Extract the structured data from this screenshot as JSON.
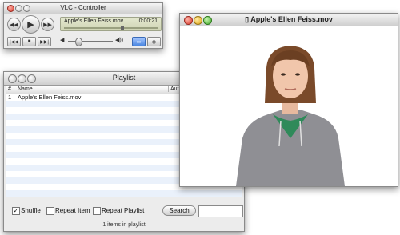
{
  "controller": {
    "title": "VLC - Controller",
    "now_playing": "Apple's Ellen Feiss.mov",
    "time": "0:00:21",
    "progress_fraction": 0.6
  },
  "playlist": {
    "title": "Playlist",
    "columns": [
      "#",
      "Name",
      "Autho"
    ],
    "rows": [
      {
        "num": "1",
        "name": "Apple's Ellen Feiss.mov"
      }
    ],
    "shuffle_label": "Shuffle",
    "shuffle_checked": true,
    "repeat_item_label": "Repeat Item",
    "repeat_item_checked": false,
    "repeat_playlist_label": "Repeat Playlist",
    "repeat_playlist_checked": false,
    "search_button": "Search",
    "search_value": "",
    "footer": "1 items in playlist"
  },
  "video": {
    "title": "Apple's Ellen Feiss.mov"
  },
  "colors": {
    "lcd_bg": "#d7dcbe",
    "row_stripe": "#eaf1fb"
  }
}
